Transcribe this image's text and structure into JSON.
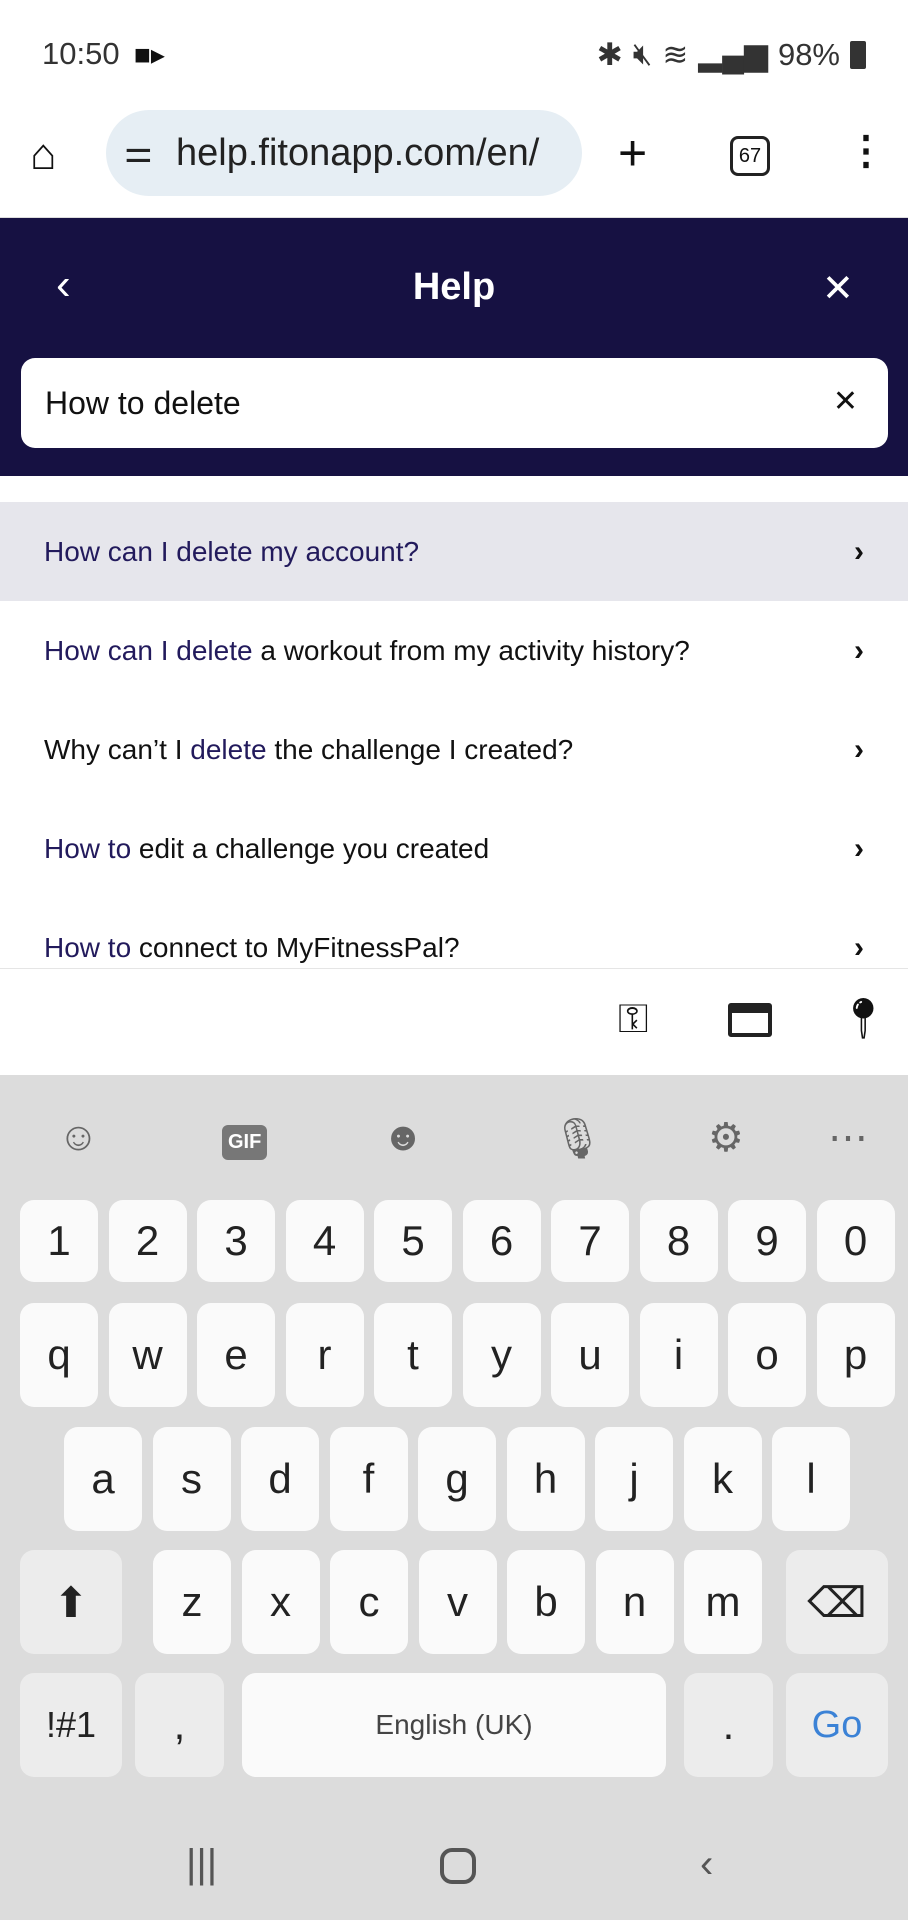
{
  "status": {
    "time": "10:50",
    "battery": "98%",
    "icons": [
      "video-icon",
      "bluetooth-icon",
      "mute-icon",
      "wifi-icon",
      "signal-icon",
      "battery-icon"
    ]
  },
  "browser": {
    "url": "help.fitonapp.com/en/",
    "tab_count": "67"
  },
  "header": {
    "title": "Help"
  },
  "search": {
    "value": "How to delete"
  },
  "results": [
    {
      "parts": [
        {
          "t": "How can I delete my account?",
          "h": true
        }
      ],
      "highlighted": true
    },
    {
      "parts": [
        {
          "t": "How can I delete",
          "h": true
        },
        {
          "t": " a workout from my activity history?",
          "h": false
        }
      ]
    },
    {
      "parts": [
        {
          "t": "Why can’t I ",
          "h": false
        },
        {
          "t": "delete",
          "h": true
        },
        {
          "t": " the challenge I created?",
          "h": false
        }
      ]
    },
    {
      "parts": [
        {
          "t": "How to",
          "h": true
        },
        {
          "t": " edit a challenge you created",
          "h": false
        }
      ]
    },
    {
      "parts": [
        {
          "t": "How to",
          "h": true
        },
        {
          "t": " connect to MyFitnessPal?",
          "h": false
        }
      ]
    }
  ],
  "keyboard": {
    "numbers": [
      "1",
      "2",
      "3",
      "4",
      "5",
      "6",
      "7",
      "8",
      "9",
      "0"
    ],
    "row1": [
      "q",
      "w",
      "e",
      "r",
      "t",
      "y",
      "u",
      "i",
      "o",
      "p"
    ],
    "row2": [
      "a",
      "s",
      "d",
      "f",
      "g",
      "h",
      "j",
      "k",
      "l"
    ],
    "row3": [
      "z",
      "x",
      "c",
      "v",
      "b",
      "n",
      "m"
    ],
    "symbols": "!#1",
    "comma": ",",
    "space": "English (UK)",
    "period": ".",
    "go": "Go",
    "gif": "GIF"
  },
  "colors": {
    "header": "#161142",
    "highlight": "#221a5c",
    "go": "#3b82d6"
  }
}
